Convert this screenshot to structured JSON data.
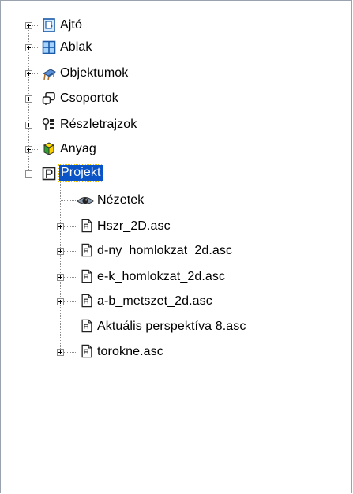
{
  "tree": {
    "items": [
      {
        "label": "Ajtó",
        "icon": "door-icon",
        "expander": "collapsed"
      },
      {
        "label": "Ablak",
        "icon": "window-icon",
        "expander": "collapsed"
      },
      {
        "label": "Objektumok",
        "icon": "objects-icon",
        "expander": "collapsed"
      },
      {
        "label": "Csoportok",
        "icon": "groups-icon",
        "expander": "collapsed"
      },
      {
        "label": "Részletrajzok",
        "icon": "details-icon",
        "expander": "collapsed"
      },
      {
        "label": "Anyag",
        "icon": "material-icon",
        "expander": "collapsed"
      },
      {
        "label": "Projekt",
        "icon": "project-icon",
        "expander": "expanded",
        "selected": true
      }
    ],
    "project_children": [
      {
        "label": "Nézetek",
        "icon": "eye-icon",
        "expander": "none"
      },
      {
        "label": "Hszr_2D.asc",
        "icon": "file-icon",
        "expander": "collapsed"
      },
      {
        "label": "d-ny_homlokzat_2d.asc",
        "icon": "file-icon",
        "expander": "collapsed"
      },
      {
        "label": "e-k_homlokzat_2d.asc",
        "icon": "file-icon",
        "expander": "collapsed"
      },
      {
        "label": "a-b_metszet_2d.asc",
        "icon": "file-icon",
        "expander": "collapsed"
      },
      {
        "label": "Aktuális perspektíva 8.asc",
        "icon": "file-icon",
        "expander": "none"
      },
      {
        "label": "torokne.asc",
        "icon": "file-icon",
        "expander": "collapsed"
      }
    ],
    "colors": {
      "selection": "#0a54c8",
      "selection_text": "#ffffff"
    }
  }
}
